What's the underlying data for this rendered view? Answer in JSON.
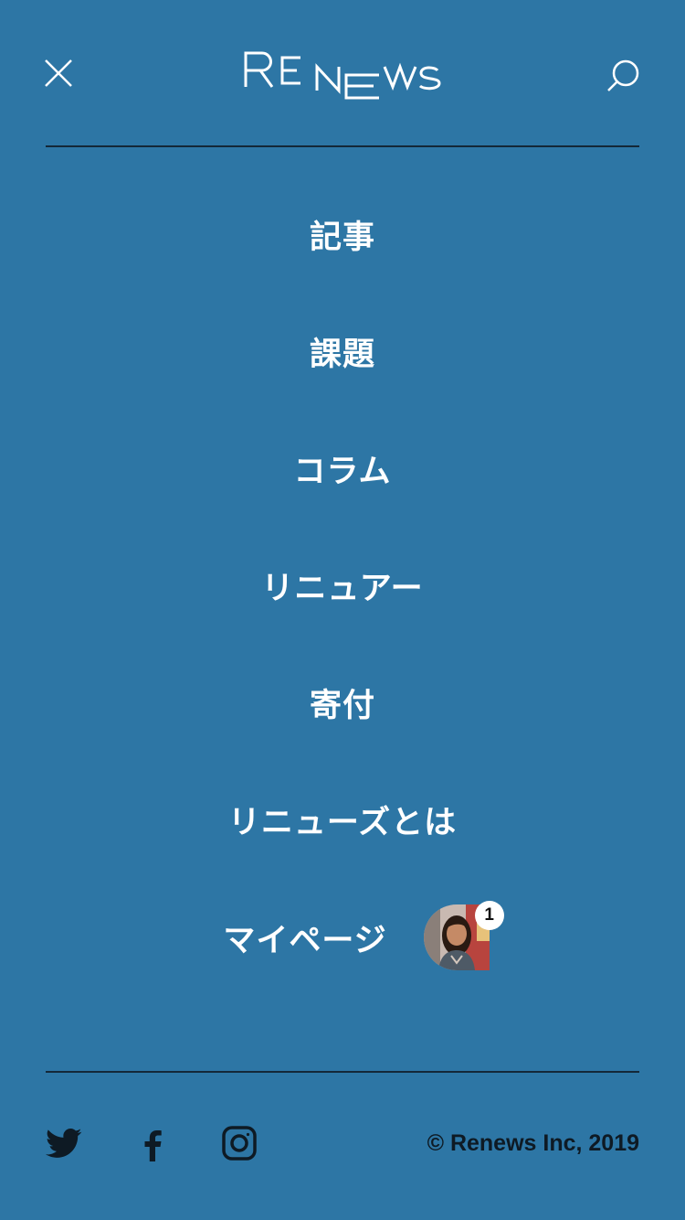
{
  "header": {
    "logo_text": "RENEWS",
    "close_icon": "close-icon",
    "search_icon": "search-icon"
  },
  "nav": {
    "items": [
      {
        "label": "記事"
      },
      {
        "label": "課題"
      },
      {
        "label": "コラム"
      },
      {
        "label": "リニュアー"
      },
      {
        "label": "寄付"
      },
      {
        "label": "リニューズとは"
      },
      {
        "label": "マイページ"
      }
    ],
    "mypage_badge": "1"
  },
  "footer": {
    "social_icons": [
      "twitter-icon",
      "facebook-icon",
      "instagram-icon"
    ],
    "copyright": "© Renews Inc, 2019"
  },
  "colors": {
    "background": "#2d76a5",
    "text": "#ffffff",
    "divider": "#142838",
    "footer_text": "#0e1a24"
  }
}
